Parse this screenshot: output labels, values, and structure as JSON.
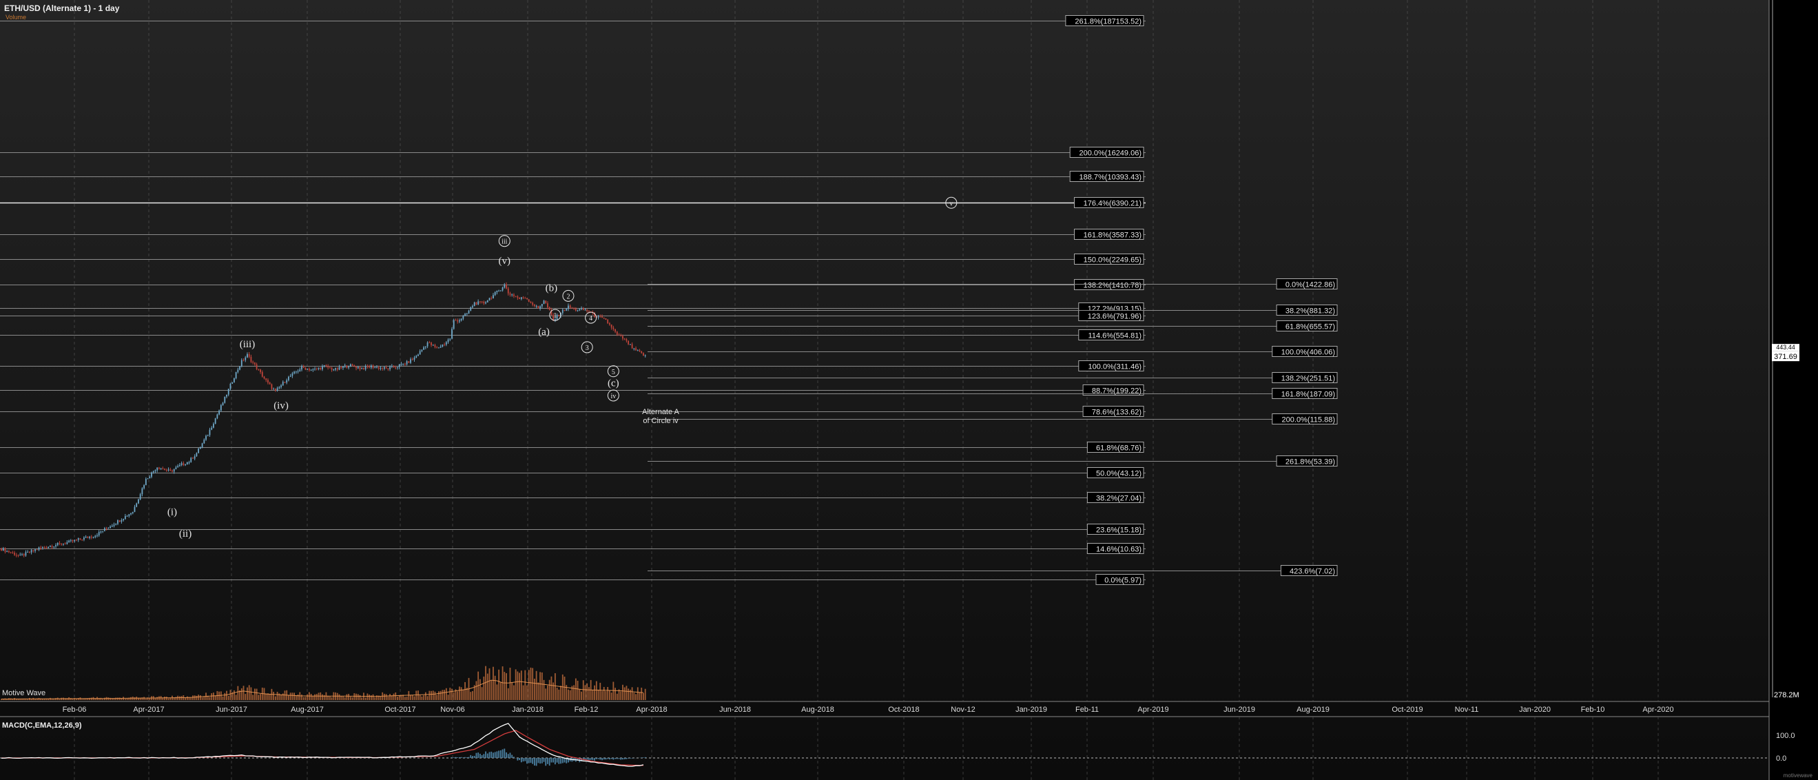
{
  "header": {
    "title": "ETH/USD (Alternate 1) - 1 day",
    "volume_label": "Volume"
  },
  "wave_label": "Motive Wave",
  "macd_label": "MACD(C,EMA,12,26,9)",
  "watermark": "motivewave",
  "colors": {
    "up": "#6fa8c8",
    "down": "#c0443a",
    "volume": "#b8683a",
    "macd": "#ffffff",
    "signal": "#d23c3c",
    "hist": "#4a7fa0",
    "grid": "#5a5a5a",
    "level": "#8a8a8a"
  },
  "chart_data": [
    {
      "type": "candlestick",
      "title": "ETH/USD (Alternate 1) - 1 day",
      "y_scale": "log",
      "last_price": "371.69",
      "price_axis_hint": "443.44",
      "x_ticks": [
        "Feb-06",
        "Apr-2017",
        "Jun-2017",
        "Aug-2017",
        "Oct-2017",
        "Nov-06",
        "Jan-2018",
        "Feb-12",
        "Apr-2018",
        "Jun-2018",
        "Aug-2018",
        "Oct-2018",
        "Nov-12",
        "Jan-2019",
        "Feb-11",
        "Apr-2019",
        "Jun-2019",
        "Aug-2019",
        "Oct-2019",
        "Nov-11",
        "Jan-2020",
        "Feb-10",
        "Apr-2020"
      ],
      "price_path": [
        [
          0,
          10.5
        ],
        [
          10,
          9.2
        ],
        [
          20,
          10.6
        ],
        [
          35,
          11.8
        ],
        [
          50,
          13.5
        ],
        [
          62,
          17.5
        ],
        [
          70,
          21
        ],
        [
          77,
          38
        ],
        [
          83,
          48
        ],
        [
          90,
          44
        ],
        [
          96,
          50
        ],
        [
          100,
          53
        ],
        [
          104,
          62
        ],
        [
          110,
          88
        ],
        [
          118,
          158
        ],
        [
          124,
          255
        ],
        [
          128,
          338
        ],
        [
          131,
          380
        ],
        [
          136,
          300
        ],
        [
          142,
          225
        ],
        [
          146,
          193
        ],
        [
          152,
          245
        ],
        [
          160,
          302
        ],
        [
          166,
          288
        ],
        [
          172,
          308
        ],
        [
          178,
          290
        ],
        [
          185,
          315
        ],
        [
          192,
          298
        ],
        [
          197,
          308
        ],
        [
          205,
          295
        ],
        [
          210,
          306
        ],
        [
          216,
          330
        ],
        [
          220,
          360
        ],
        [
          224,
          420
        ],
        [
          227,
          480
        ],
        [
          232,
          430
        ],
        [
          236,
          470
        ],
        [
          239,
          520
        ],
        [
          241,
          720
        ],
        [
          244,
          730
        ],
        [
          248,
          820
        ],
        [
          252,
          1000
        ],
        [
          257,
          1000
        ],
        [
          262,
          1150
        ],
        [
          266,
          1300
        ],
        [
          268,
          1400
        ],
        [
          270,
          1200
        ],
        [
          273,
          1150
        ],
        [
          276,
          1080
        ],
        [
          279,
          1110
        ],
        [
          283,
          980
        ],
        [
          286,
          900
        ],
        [
          289,
          1050
        ],
        [
          292,
          860
        ],
        [
          294,
          720
        ],
        [
          298,
          840
        ],
        [
          302,
          930
        ],
        [
          306,
          880
        ],
        [
          310,
          880
        ],
        [
          313,
          860
        ],
        [
          316,
          790
        ],
        [
          319,
          760
        ],
        [
          322,
          720
        ],
        [
          325,
          640
        ],
        [
          328,
          550
        ],
        [
          331,
          520
        ],
        [
          334,
          470
        ],
        [
          337,
          420
        ],
        [
          340,
          400
        ],
        [
          343,
          372
        ]
      ],
      "volume_relative": [
        [
          0,
          0.05
        ],
        [
          60,
          0.08
        ],
        [
          100,
          0.12
        ],
        [
          120,
          0.25
        ],
        [
          128,
          0.45
        ],
        [
          140,
          0.3
        ],
        [
          160,
          0.2
        ],
        [
          200,
          0.18
        ],
        [
          230,
          0.28
        ],
        [
          250,
          0.55
        ],
        [
          262,
          1.0
        ],
        [
          268,
          0.8
        ],
        [
          276,
          0.9
        ],
        [
          290,
          0.75
        ],
        [
          310,
          0.5
        ],
        [
          330,
          0.45
        ],
        [
          343,
          0.35
        ]
      ],
      "macd": [
        [
          0,
          0
        ],
        [
          100,
          0.5
        ],
        [
          128,
          8
        ],
        [
          140,
          3
        ],
        [
          160,
          2
        ],
        [
          200,
          1
        ],
        [
          230,
          6
        ],
        [
          250,
          35
        ],
        [
          265,
          90
        ],
        [
          270,
          100
        ],
        [
          276,
          60
        ],
        [
          286,
          30
        ],
        [
          295,
          5
        ],
        [
          305,
          -5
        ],
        [
          320,
          -15
        ],
        [
          335,
          -25
        ],
        [
          343,
          -20
        ]
      ],
      "signal": [
        [
          0,
          0
        ],
        [
          100,
          0.5
        ],
        [
          130,
          6
        ],
        [
          145,
          3
        ],
        [
          165,
          2
        ],
        [
          200,
          1
        ],
        [
          232,
          5
        ],
        [
          252,
          25
        ],
        [
          268,
          70
        ],
        [
          274,
          80
        ],
        [
          282,
          55
        ],
        [
          292,
          25
        ],
        [
          302,
          5
        ],
        [
          315,
          -10
        ],
        [
          330,
          -20
        ],
        [
          343,
          -22
        ]
      ],
      "hist": [
        [
          250,
          8
        ],
        [
          262,
          18
        ],
        [
          268,
          25
        ],
        [
          276,
          -10
        ],
        [
          286,
          -20
        ],
        [
          296,
          -15
        ],
        [
          306,
          -10
        ],
        [
          318,
          -5
        ],
        [
          330,
          -4
        ],
        [
          343,
          2
        ]
      ],
      "macd_axis": [
        "100.0",
        "0.0"
      ],
      "volume_axis_label": "278.2M",
      "wave_labels": [
        {
          "text": "(i)",
          "d": 91,
          "price": 21
        },
        {
          "text": "(ii)",
          "d": 98,
          "price": 14
        },
        {
          "text": "(iii)",
          "d": 131,
          "price": 470
        },
        {
          "text": "(iv)",
          "d": 149,
          "price": 150
        },
        {
          "text": "iii",
          "d": 268,
          "price": 3150,
          "circle": true
        },
        {
          "text": "(v)",
          "d": 268,
          "price": 2200
        },
        {
          "text": "(b)",
          "d": 293,
          "price": 1330
        },
        {
          "text": "(a)",
          "d": 289,
          "price": 590
        },
        {
          "text": "2",
          "d": 302,
          "price": 1140,
          "circle": true
        },
        {
          "text": "1",
          "d": 295,
          "price": 800,
          "circle": true
        },
        {
          "text": "4",
          "d": 314,
          "price": 760,
          "circle": true
        },
        {
          "text": "3",
          "d": 312,
          "price": 440,
          "circle": true
        },
        {
          "text": "5",
          "d": 326,
          "price": 282,
          "circle": true
        },
        {
          "text": "(c)",
          "d": 326,
          "price": 228
        },
        {
          "text": "iv",
          "d": 326,
          "price": 180,
          "circle": true
        },
        {
          "text": "v",
          "d": 506,
          "price": 6390,
          "circle": true
        }
      ],
      "note_lines": [
        "Alternate A",
        "of Circle iv"
      ],
      "fib_levels_set1": [
        {
          "label": "261.8%(187153.52)",
          "price": 187153.52
        },
        {
          "label": "200.0%(16249.06)",
          "price": 16249.06
        },
        {
          "label": "188.7%(10393.43)",
          "price": 10393.43
        },
        {
          "label": "176.4%(6390.21)",
          "price": 6390.21,
          "bright": true
        },
        {
          "label": "161.8%(3587.33)",
          "price": 3587.33
        },
        {
          "label": "150.0%(2249.65)",
          "price": 2249.65
        },
        {
          "label": "138.2%(1410.78)",
          "price": 1410.78
        },
        {
          "label": "127.2%(913.15)",
          "price": 913.15
        },
        {
          "label": "123.6%(791.96)",
          "price": 791.96
        },
        {
          "label": "114.6%(554.81)",
          "price": 554.81
        },
        {
          "label": "100.0%(311.46)",
          "price": 311.46
        },
        {
          "label": "88.7%(199.22)",
          "price": 199.22
        },
        {
          "label": "78.6%(133.62)",
          "price": 133.62
        },
        {
          "label": "61.8%(68.76)",
          "price": 68.76
        },
        {
          "label": "50.0%(43.12)",
          "price": 43.12
        },
        {
          "label": "38.2%(27.04)",
          "price": 27.04
        },
        {
          "label": "23.6%(15.18)",
          "price": 15.18
        },
        {
          "label": "14.6%(10.63)",
          "price": 10.63
        },
        {
          "label": "0.0%(5.97)",
          "price": 5.97
        }
      ],
      "fib_levels_set2": [
        {
          "label": "0.0%(1422.86)",
          "price": 1422.86
        },
        {
          "label": "38.2%(881.32)",
          "price": 881.32
        },
        {
          "label": "61.8%(655.57)",
          "price": 655.57
        },
        {
          "label": "100.0%(406.06)",
          "price": 406.06
        },
        {
          "label": "138.2%(251.51)",
          "price": 251.51
        },
        {
          "label": "161.8%(187.09)",
          "price": 187.09
        },
        {
          "label": "200.0%(115.88)",
          "price": 115.88
        },
        {
          "label": "261.8%(53.39)",
          "price": 53.39
        },
        {
          "label": "423.6%(7.02)",
          "price": 7.02
        }
      ]
    }
  ]
}
